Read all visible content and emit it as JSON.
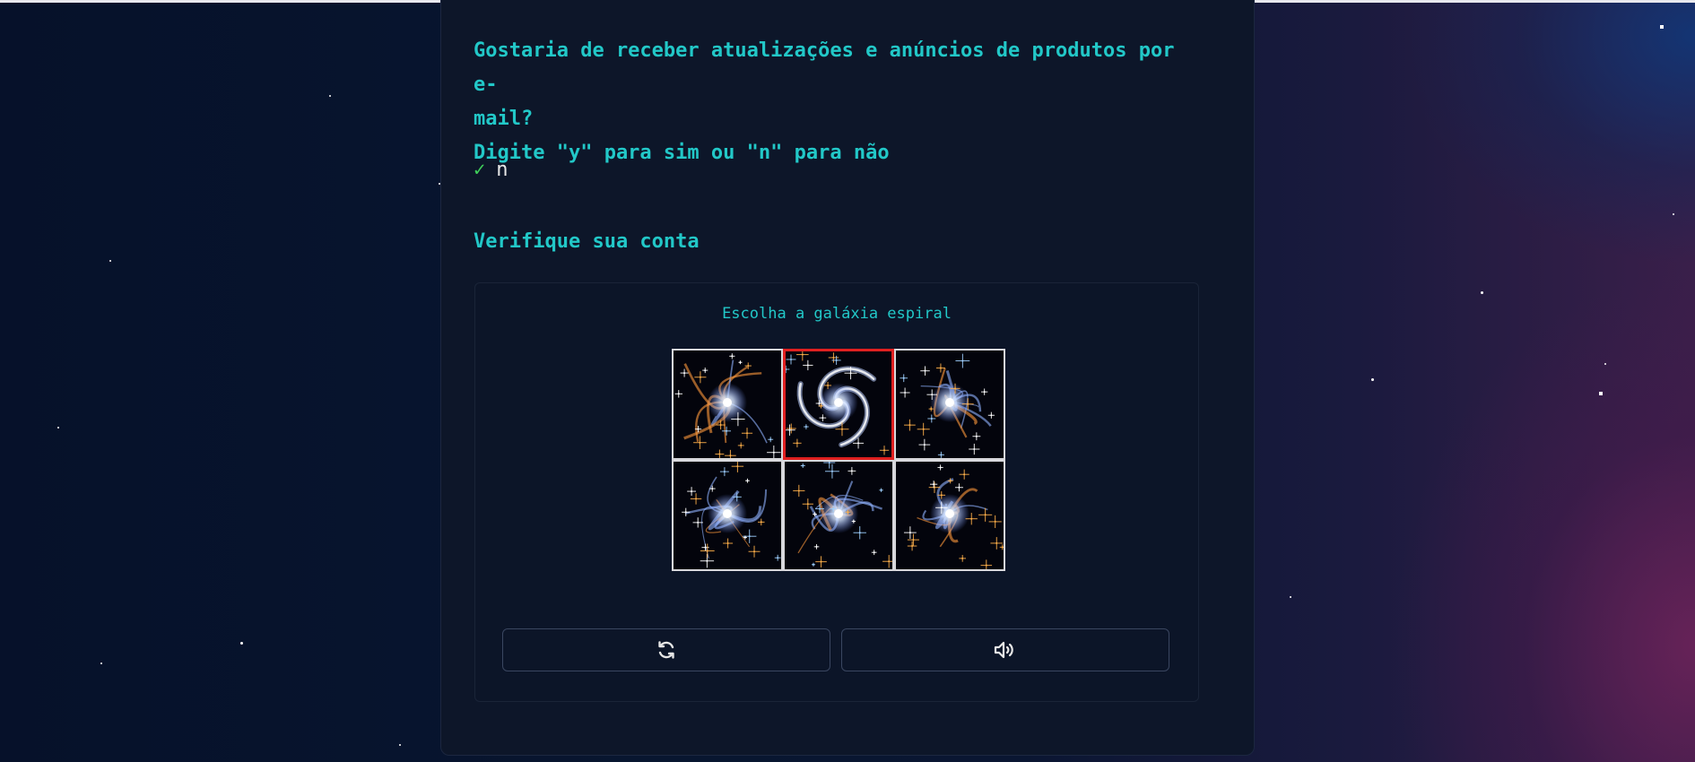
{
  "question": {
    "line1": "Gostaria de receber atualizações e anúncios de produtos por e-",
    "line2": "mail?",
    "line3": "Digite \"y\" para sim ou \"n\" para não"
  },
  "answer": {
    "check_glyph": "✓",
    "value": "n"
  },
  "verify": {
    "title": "Verifique sua conta",
    "instruction": "Escolha a galáxia espiral",
    "tiles": [
      {
        "kind": "cloudy-galaxy",
        "selected": false
      },
      {
        "kind": "spiral-galaxy",
        "selected": true
      },
      {
        "kind": "cloudy-galaxy",
        "selected": false
      },
      {
        "kind": "cloudy-galaxy",
        "selected": false
      },
      {
        "kind": "cloudy-galaxy",
        "selected": false
      },
      {
        "kind": "cloudy-galaxy",
        "selected": false
      }
    ],
    "refresh_icon": "refresh-icon",
    "audio_icon": "speaker-icon"
  },
  "colors": {
    "accent": "#22c8c8",
    "check": "#3fcf5a",
    "selected_border": "#e02020",
    "panel": "#0d1629"
  }
}
